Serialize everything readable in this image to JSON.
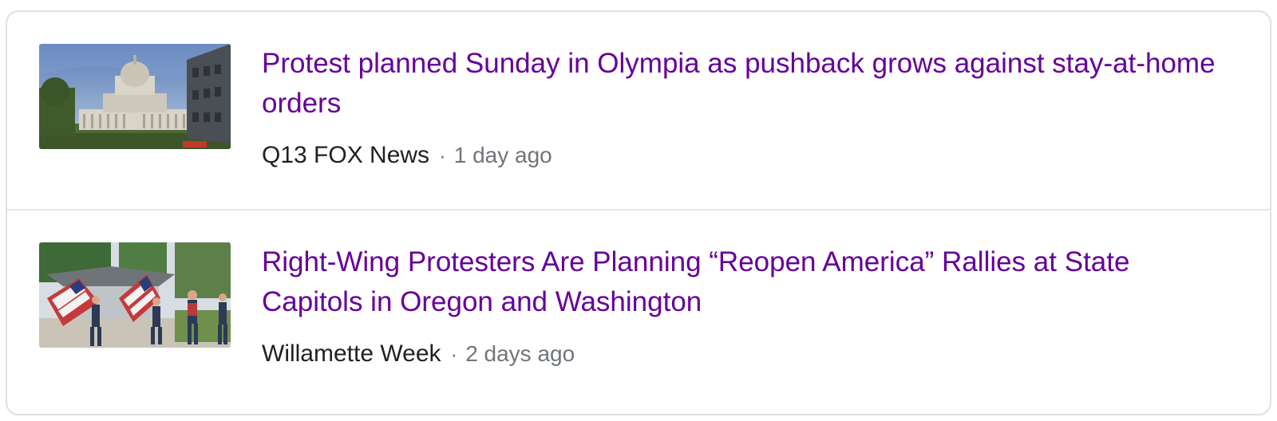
{
  "results": [
    {
      "headline": "Protest planned Sunday in Olympia as pushback grows against stay-at-home orders",
      "source": "Q13 FOX News",
      "separator": "·",
      "time": "1 day ago",
      "thumbnail": "capitol-building-photo"
    },
    {
      "headline": "Right-Wing Protesters Are Planning “Reopen America” Rallies at State Capitols in Oregon and Washington",
      "source": "Willamette Week",
      "separator": "·",
      "time": "2 days ago",
      "thumbnail": "protesters-with-flags-photo"
    }
  ],
  "colors": {
    "visited_link": "#660099",
    "source": "#202124",
    "meta": "#70757a",
    "border": "#e0e0e0"
  }
}
